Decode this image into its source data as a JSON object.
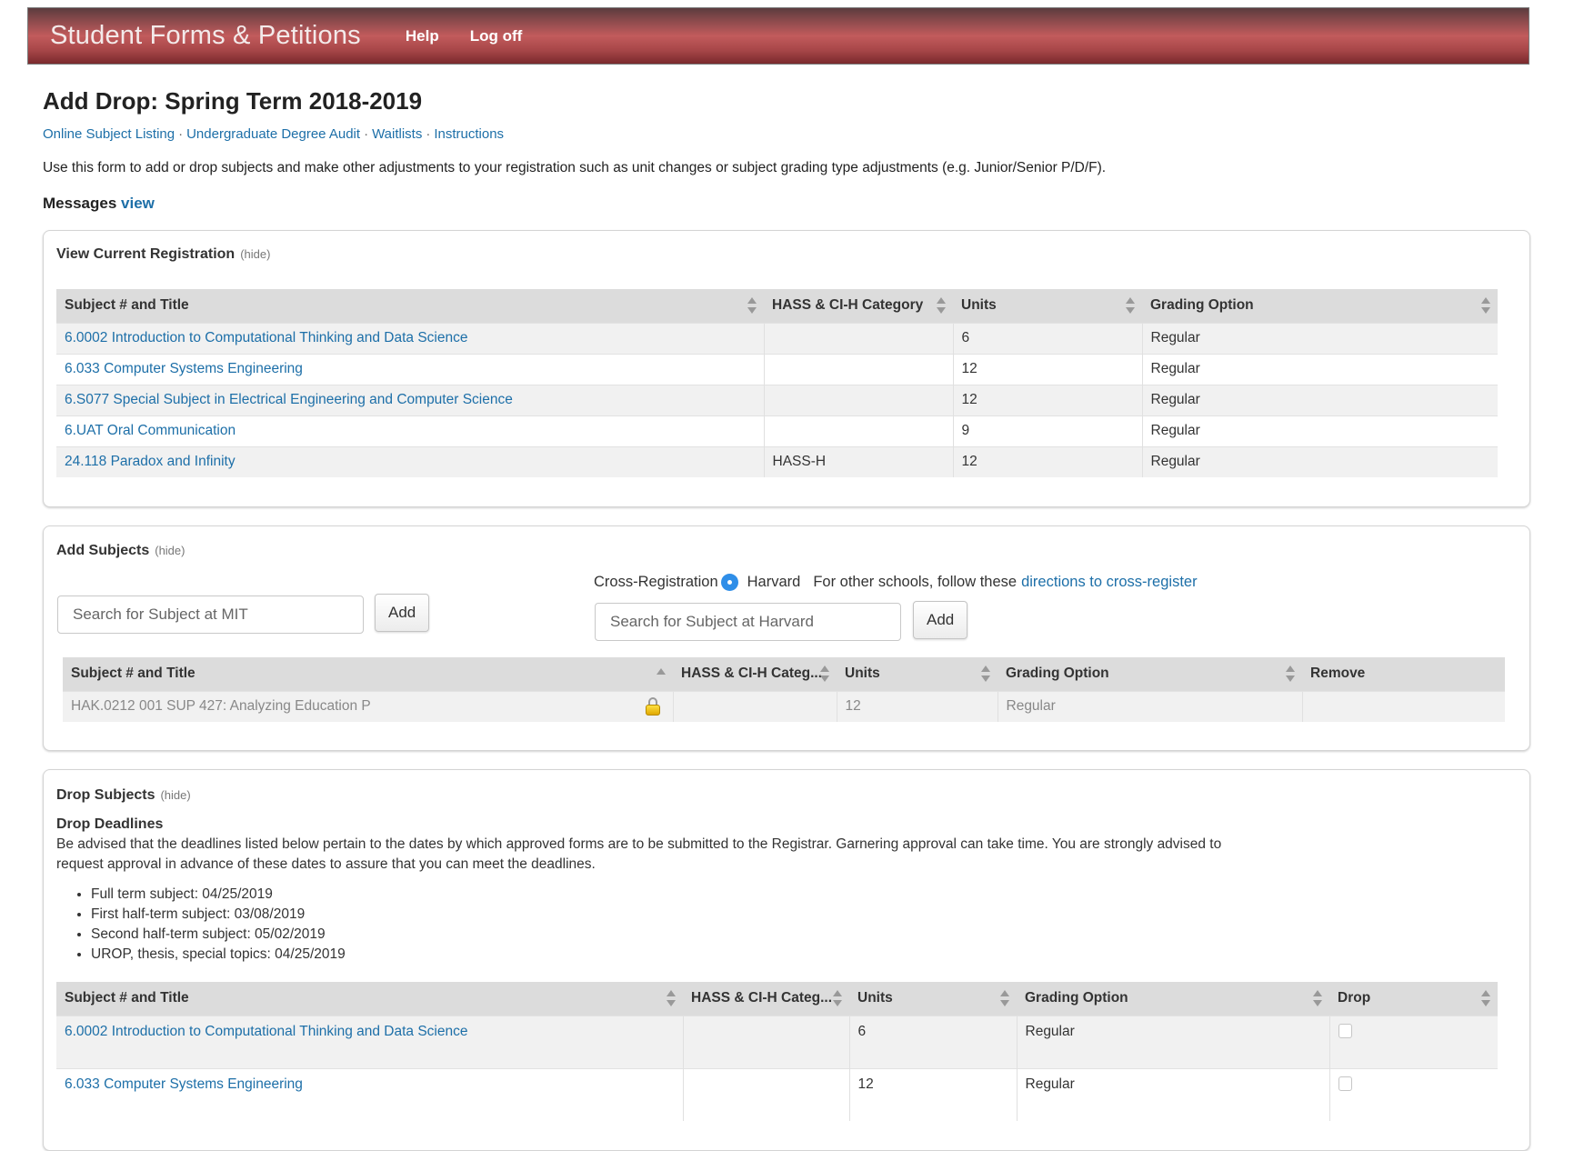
{
  "header": {
    "brand": "Student Forms & Petitions",
    "nav": [
      "Help",
      "Log off"
    ],
    "brand_color": "#c25b5c"
  },
  "page": {
    "title": "Add Drop: Spring Term 2018-2019",
    "quick_links": [
      "Online Subject Listing",
      "Undergraduate Degree Audit",
      "Waitlists",
      "Instructions"
    ],
    "link_separator": "·",
    "intro": "Use this form to add or drop subjects and make other adjustments to your registration such as unit changes or subject grading type adjustments (e.g. Junior/Senior P/D/F).",
    "messages_label": "Messages",
    "messages_link": "view"
  },
  "current_registration": {
    "title": "View Current Registration",
    "hide_label": "(hide)",
    "columns": [
      "Subject # and Title",
      "HASS & CI-H Category",
      "Units",
      "Grading Option"
    ],
    "rows": [
      {
        "subject": "6.0002 Introduction to Computational Thinking and Data Science",
        "category": "",
        "units": "6",
        "grading": "Regular"
      },
      {
        "subject": "6.033 Computer Systems Engineering",
        "category": "",
        "units": "12",
        "grading": "Regular"
      },
      {
        "subject": "6.S077 Special Subject in Electrical Engineering and Computer Science",
        "category": "",
        "units": "12",
        "grading": "Regular"
      },
      {
        "subject": "6.UAT Oral Communication",
        "category": "",
        "units": "9",
        "grading": "Regular"
      },
      {
        "subject": "24.118 Paradox and Infinity",
        "category": "HASS-H",
        "units": "12",
        "grading": "Regular"
      }
    ]
  },
  "add_subjects": {
    "title": "Add Subjects",
    "hide_label": "(hide)",
    "mit_search_placeholder": "Search for Subject at MIT",
    "add_label": "Add",
    "cross_registration_label": "Cross-Registration",
    "cross_registration_option": "Harvard",
    "other_schools_text": "For other schools, follow these",
    "other_schools_link": "directions to cross-register",
    "harvard_search_placeholder": "Search for Subject at Harvard",
    "columns": [
      "Subject # and Title",
      "HASS & CI-H Categ...",
      "Units",
      "Grading Option",
      "Remove"
    ],
    "rows": [
      {
        "subject": "HAK.0212 001 SUP 427: Analyzing Education P",
        "locked": true,
        "category": "",
        "units": "12",
        "grading": "Regular",
        "remove": ""
      }
    ]
  },
  "drop_subjects": {
    "title": "Drop Subjects",
    "hide_label": "(hide)",
    "deadlines_heading": "Drop Deadlines",
    "deadlines_text": "Be advised that the deadlines listed below pertain to the dates by which approved forms are to be submitted to the Registrar. Garnering approval can take time. You are strongly advised to request approval in advance of these dates to assure that you can meet the deadlines.",
    "deadlines": [
      "Full term subject: 04/25/2019",
      "First half-term subject: 03/08/2019",
      "Second half-term subject: 05/02/2019",
      "UROP, thesis, special topics: 04/25/2019"
    ],
    "columns": [
      "Subject # and Title",
      "HASS & CI-H Categ...",
      "Units",
      "Grading Option",
      "Drop"
    ],
    "rows": [
      {
        "subject": "6.0002 Introduction to Computational Thinking and Data Science",
        "category": "",
        "units": "6",
        "grading": "Regular",
        "drop": false
      },
      {
        "subject": "6.033 Computer Systems Engineering",
        "category": "",
        "units": "12",
        "grading": "Regular",
        "drop": false
      }
    ]
  }
}
